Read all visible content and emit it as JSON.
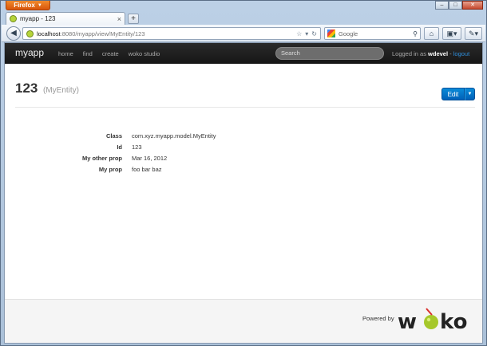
{
  "browser": {
    "menu_label": "Firefox",
    "tab_title": "myapp - 123",
    "new_tab": "+",
    "url_host": "localhost",
    "url_path": ":8080/myapp/view/MyEntity/123",
    "search_placeholder": "Google"
  },
  "app": {
    "brand": "myapp",
    "nav": [
      "home",
      "find",
      "create",
      "woko studio"
    ],
    "search_placeholder": "Search",
    "login_prefix": "Logged in as",
    "username": "wdevel",
    "logout_sep": "-",
    "logout": "logout"
  },
  "page": {
    "title": "123",
    "entity_type": "(MyEntity)",
    "edit_label": "Edit"
  },
  "props": [
    {
      "key": "Class",
      "value": "com.xyz.myapp.model.MyEntity"
    },
    {
      "key": "Id",
      "value": "123"
    },
    {
      "key": "My other prop",
      "value": "Mar 16, 2012"
    },
    {
      "key": "My prop",
      "value": "foo bar baz"
    }
  ],
  "footer": {
    "powered_by": "Powered by",
    "logo_text": "woko"
  },
  "colors": {
    "accent": "#0070c9",
    "navbar": "#1f1f1f",
    "logo_green": "#a6c82b"
  }
}
